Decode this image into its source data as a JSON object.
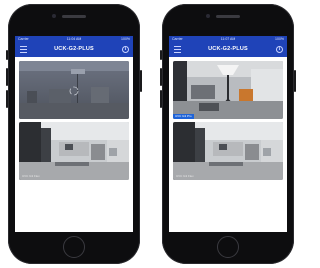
{
  "devices": [
    {
      "status": {
        "carrier": "Carrier",
        "time": "11:04 AM",
        "battery": "100%"
      },
      "title": "UCK-G2-PLUS",
      "feeds": [
        {
          "label": ""
        },
        {
          "label": "UVC G3 Flex"
        }
      ]
    },
    {
      "status": {
        "carrier": "Carrier",
        "time": "11:07 AM",
        "battery": "100%"
      },
      "title": "UCK-G2-PLUS",
      "feeds": [
        {
          "label": "UVC G3 Pro"
        },
        {
          "label": "UVC G3 Flex"
        }
      ]
    }
  ],
  "icons": {
    "menu": "hamburger-menu-icon",
    "info": "info-icon"
  },
  "colors": {
    "accent": "#1f43b8",
    "live_badge": "#1e63d8"
  }
}
